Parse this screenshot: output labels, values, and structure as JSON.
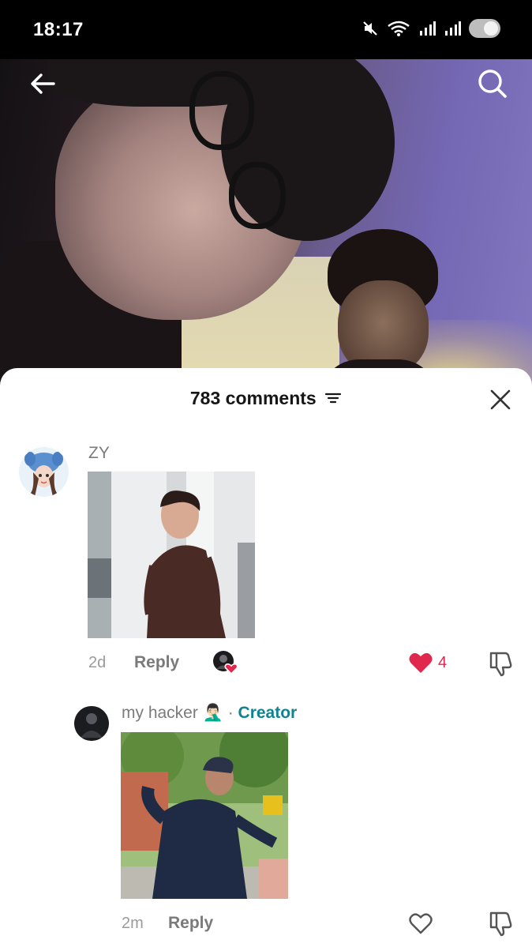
{
  "status_bar": {
    "time": "18:17",
    "icons": [
      "mute-icon",
      "wifi-icon",
      "signal-icon",
      "signal-icon",
      "toggle-icon"
    ]
  },
  "video": {
    "back_icon": "arrow-left-icon",
    "search_icon": "search-icon"
  },
  "comments_sheet": {
    "title": "783 comments",
    "filter_icon": "filter-icon",
    "close_icon": "close-icon",
    "comments": [
      {
        "username": "ZY",
        "time": "2d",
        "reply_label": "Reply",
        "likes": "4",
        "liked": true
      },
      {
        "username": "my hacker 🤦🏻‍♂️",
        "separator": "·",
        "badge": "Creator",
        "time": "2m",
        "reply_label": "Reply",
        "liked": false
      }
    ]
  },
  "colors": {
    "like_red": "#e0274d",
    "creator_teal": "#11838f",
    "meta_grey": "#9b9b9b"
  }
}
